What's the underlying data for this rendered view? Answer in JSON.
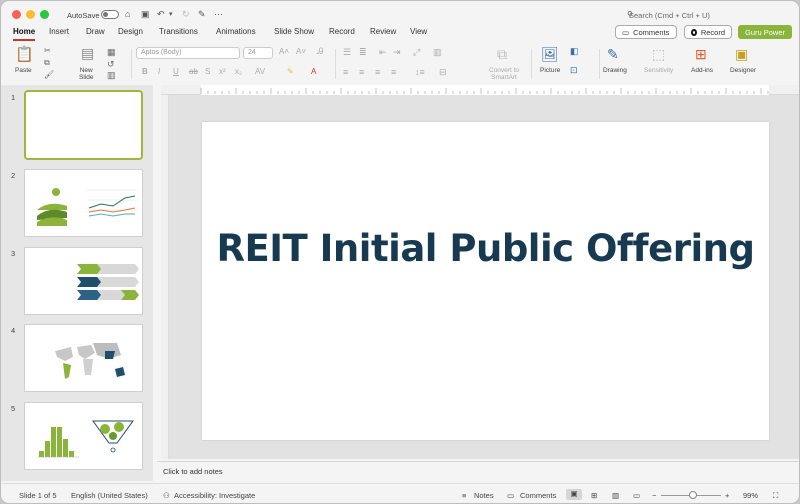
{
  "titlebar": {
    "autosave_label": "AutoSave",
    "search_placeholder": "Search (Cmd + Ctrl + U)"
  },
  "tabs": [
    "Home",
    "Insert",
    "Draw",
    "Design",
    "Transitions",
    "Animations",
    "Slide Show",
    "Record",
    "Review",
    "View"
  ],
  "tab_active": "Home",
  "actions": {
    "comments": "Comments",
    "record": "Record",
    "guru": "Guru Power"
  },
  "ribbon": {
    "paste": "Paste",
    "new_slide": "New\nSlide",
    "font_name": "Aptos (Body)",
    "font_size": "24",
    "convert": "Convert to\nSmartArt",
    "picture": "Picture",
    "drawing": "Drawing",
    "sensitivity": "Sensitivity",
    "addins": "Add-ins",
    "designer": "Designer"
  },
  "slides": [
    {
      "num": "1"
    },
    {
      "num": "2"
    },
    {
      "num": "3"
    },
    {
      "num": "4"
    },
    {
      "num": "5"
    }
  ],
  "slide_title": "REIT Initial Public Offering",
  "notes_placeholder": "Click to add notes",
  "status": {
    "slide_of": "Slide 1 of 5",
    "language": "English (United States)",
    "accessibility": "Accessibility: Investigate",
    "notes": "Notes",
    "comments": "Comments",
    "zoom": "99%"
  },
  "colors": {
    "accent_green": "#8bb43a",
    "title_navy": "#173a50",
    "active_tab_underline": "#c0392b"
  }
}
